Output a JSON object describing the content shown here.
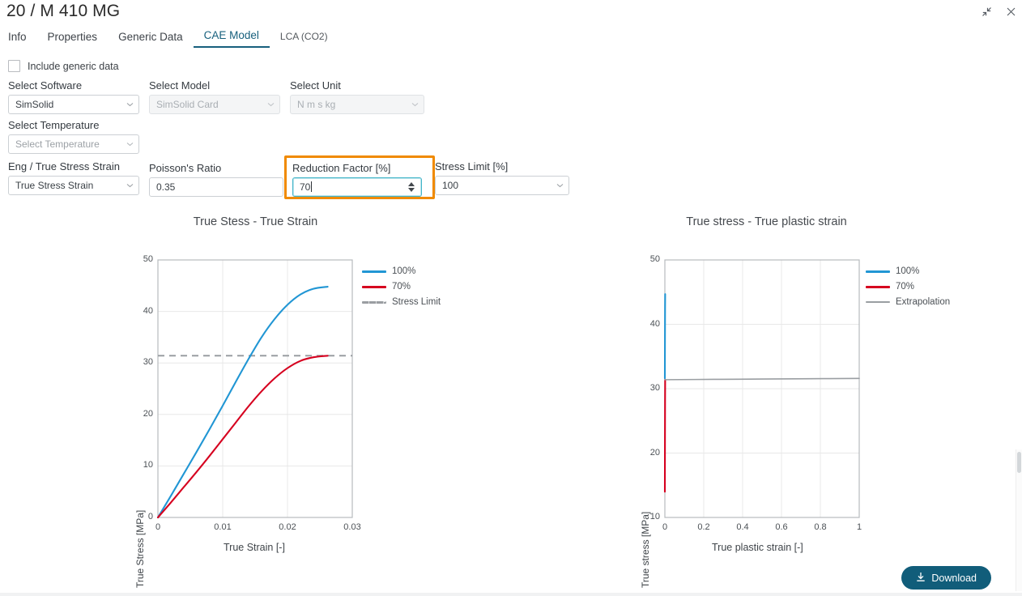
{
  "window": {
    "title": "20 / M 410 MG",
    "controls": [
      {
        "name": "collapse-icon",
        "glyph": "collapse"
      },
      {
        "name": "close-icon",
        "glyph": "close"
      }
    ]
  },
  "tabs": [
    {
      "label": "Info",
      "active": false
    },
    {
      "label": "Properties",
      "active": false
    },
    {
      "label": "Generic Data",
      "active": false
    },
    {
      "label": "CAE Model",
      "active": true
    },
    {
      "label": "LCA (CO2)",
      "active": false
    }
  ],
  "checkbox": {
    "label": "Include generic data",
    "checked": false
  },
  "form": {
    "select_software": {
      "label": "Select Software",
      "value": "SimSolid",
      "disabled": false
    },
    "select_model": {
      "label": "Select Model",
      "value": "SimSolid Card",
      "disabled": true
    },
    "select_unit": {
      "label": "Select Unit",
      "value": "N m s kg",
      "disabled": true
    },
    "select_temperature": {
      "label": "Select Temperature",
      "placeholder": "Select Temperature",
      "value": "",
      "disabled": false
    },
    "stress_strain_type": {
      "label": "Eng / True Stress Strain",
      "value": "True Stress Strain",
      "disabled": false
    },
    "poissons_ratio": {
      "label": "Poisson's Ratio",
      "value": "0.35"
    },
    "reduction_factor": {
      "label": "Reduction Factor [%]",
      "value": "70",
      "focused": true,
      "highlighted": true
    },
    "stress_limit": {
      "label": "Stress Limit [%]",
      "value": "100",
      "disabled": false
    }
  },
  "colors": {
    "accent": "#17607d",
    "highlight": "#f08a00",
    "focus": "#43b5c9",
    "series_100": "#2196d4",
    "series_70": "#d6001f",
    "extrapolation": "#9a9ea2",
    "stress_limit": "#9a9ea2",
    "download_bg": "#115d7a"
  },
  "footer": {
    "download_label": "Download",
    "download_icon": "download-icon"
  },
  "chart_data": [
    {
      "id": "true-stress-true-strain",
      "type": "line",
      "title": "True Stess - True Strain",
      "xlabel": "True Strain [-]",
      "ylabel": "True Stress [MPa]",
      "xlim": [
        0,
        0.03
      ],
      "ylim": [
        0,
        50
      ],
      "xticks": [
        "0",
        "0.01",
        "0.02",
        "0.03"
      ],
      "xtick_values": [
        0,
        0.01,
        0.02,
        0.03
      ],
      "yticks": [
        "0",
        "10",
        "20",
        "30",
        "40",
        "50"
      ],
      "ytick_values": [
        0,
        10,
        20,
        30,
        40,
        50
      ],
      "grid": true,
      "legend_position": "right",
      "series": [
        {
          "name": "100%",
          "color": "#2196d4",
          "style": "solid",
          "x": [
            0,
            0.002,
            0.004,
            0.006,
            0.008,
            0.01,
            0.012,
            0.014,
            0.016,
            0.018,
            0.02,
            0.022,
            0.024,
            0.0262
          ],
          "y": [
            0,
            4.2,
            8.5,
            12.8,
            17.2,
            21.7,
            26.3,
            30.8,
            35.0,
            38.5,
            41.3,
            43.3,
            44.4,
            44.8
          ]
        },
        {
          "name": "70%",
          "color": "#d6001f",
          "style": "solid",
          "x": [
            0,
            0.002,
            0.004,
            0.006,
            0.008,
            0.01,
            0.012,
            0.014,
            0.016,
            0.018,
            0.02,
            0.022,
            0.024,
            0.0262
          ],
          "y": [
            0,
            2.9,
            5.9,
            8.9,
            12.0,
            15.2,
            18.4,
            21.6,
            24.5,
            27.0,
            29.0,
            30.4,
            31.1,
            31.4
          ]
        }
      ],
      "reference_lines": [
        {
          "name": "Stress Limit",
          "color": "#9a9ea2",
          "style": "dashed",
          "orientation": "horizontal",
          "value": 31.4
        }
      ],
      "legend": [
        {
          "label": "100%",
          "color": "#2196d4",
          "style": "solid"
        },
        {
          "label": "70%",
          "color": "#d6001f",
          "style": "solid"
        },
        {
          "label": "Stress Limit",
          "color": "#9a9ea2",
          "style": "dashed"
        }
      ]
    },
    {
      "id": "true-stress-true-plastic-strain",
      "type": "line",
      "title": "True stress - True plastic strain",
      "xlabel": "True plastic strain [-]",
      "ylabel": "True stress [MPa]",
      "xlim": [
        0,
        1
      ],
      "ylim": [
        10,
        50
      ],
      "xticks": [
        "0",
        "0.2",
        "0.4",
        "0.6",
        "0.8",
        "1"
      ],
      "xtick_values": [
        0,
        0.2,
        0.4,
        0.6,
        0.8,
        1
      ],
      "yticks": [
        "10",
        "20",
        "30",
        "40",
        "50"
      ],
      "ytick_values": [
        10,
        20,
        30,
        40,
        50
      ],
      "grid": true,
      "legend_position": "right",
      "series": [
        {
          "name": "100%",
          "color": "#2196d4",
          "style": "solid",
          "x": [
            0,
            0.0005,
            0.001,
            0.0015
          ],
          "y": [
            31.6,
            38.0,
            42.5,
            44.7
          ]
        },
        {
          "name": "70%",
          "color": "#d6001f",
          "style": "solid",
          "x": [
            0,
            0.0005,
            0.001,
            0.0015
          ],
          "y": [
            14.0,
            22.0,
            28.0,
            31.4
          ]
        },
        {
          "name": "Extrapolation",
          "color": "#9a9ea2",
          "style": "solid",
          "x": [
            0,
            0.25,
            0.5,
            0.75,
            1
          ],
          "y": [
            31.4,
            31.45,
            31.5,
            31.55,
            31.6
          ]
        }
      ],
      "legend": [
        {
          "label": "100%",
          "color": "#2196d4",
          "style": "solid"
        },
        {
          "label": "70%",
          "color": "#d6001f",
          "style": "solid"
        },
        {
          "label": "Extrapolation",
          "color": "#9a9ea2",
          "style": "solid"
        }
      ]
    }
  ]
}
